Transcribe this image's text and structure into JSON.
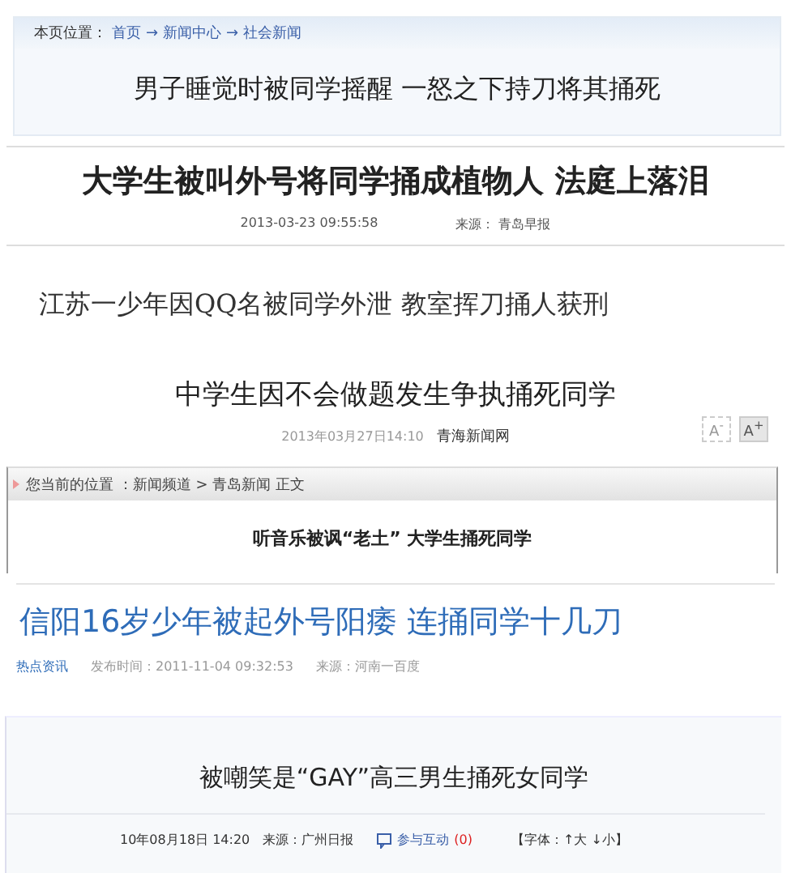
{
  "clips": [
    {
      "kind": "boxed",
      "breadcrumb": {
        "label": "本页位置：",
        "links": [
          "首页",
          "→",
          "新闻中心",
          "→",
          "社会新闻"
        ]
      },
      "headline": "男子睡觉时被同学摇醒  一怒之下持刀将其捅死"
    },
    {
      "kind": "serif",
      "headline": "大学生被叫外号将同学捅成植物人  法庭上落泪",
      "meta": [
        "2013-03-23 09:55:58",
        "来源：  青岛早报"
      ]
    },
    {
      "kind": "plain",
      "headline": "江苏一少年因QQ名被同学外泄  教室挥刀捅人获刑"
    },
    {
      "kind": "sized",
      "headline": "中学生因不会做题发生争执捅死同学",
      "meta": [
        "2013年03月27日14:10",
        "青海新闻网"
      ],
      "size_buttons": [
        {
          "label": "A$^{-}$",
          "selected": false
        },
        {
          "label": "A$^{+}$",
          "selected": true
        }
      ]
    },
    {
      "kind": "framed",
      "breadcrumb": {
        "label": "您当前的位置 ：新闻频道 > 青岛新闻 正文"
      },
      "headline": "听音乐被讽“老土”    大学生捅死同学"
    },
    {
      "kind": "blue",
      "headline": "信阳16岁少年被起外号阳痿 连捅同学十几刀",
      "tag": "热点资讯",
      "meta": [
        "发布时间：2011-11-04 09:32:53",
        "来源：河南一百度"
      ]
    },
    {
      "kind": "boxed2",
      "headline": "被嘲笑是“GAY”高三男生捅死女同学",
      "meta": [
        "10年08月18日 14:20",
        "来源：广州日报"
      ],
      "interact": {
        "label": "参与互动",
        "count": "(0)"
      },
      "font_control": "【字体：↑大 ↓小】"
    }
  ]
}
